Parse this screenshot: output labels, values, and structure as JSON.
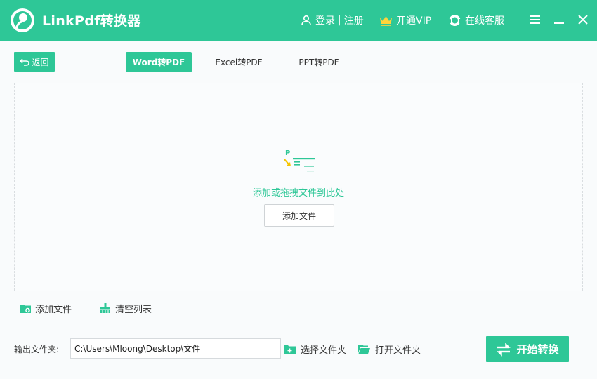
{
  "header": {
    "app_title": "LinkPdf转换器",
    "login": "登录",
    "separator": "|",
    "register": "注册",
    "vip": "开通VIP",
    "service": "在线客服"
  },
  "toolbar": {
    "back_label": "返回"
  },
  "tabs": [
    {
      "label": "Word转PDF",
      "active": true
    },
    {
      "label": "Excel转PDF",
      "active": false
    },
    {
      "label": "PPT转PDF",
      "active": false
    }
  ],
  "dropzone": {
    "hint": "添加或拖拽文件到此处",
    "add_button": "添加文件"
  },
  "file_actions": {
    "add": "添加文件",
    "clear": "清空列表"
  },
  "output": {
    "label": "输出文件夹:",
    "path": "C:\\Users\\Mloong\\Desktop\\文件",
    "choose_folder": "选择文件夹",
    "open_folder": "打开文件夹"
  },
  "start_button": "开始转换",
  "colors": {
    "accent": "#2ec797",
    "accent_dark": "#24a77e"
  }
}
